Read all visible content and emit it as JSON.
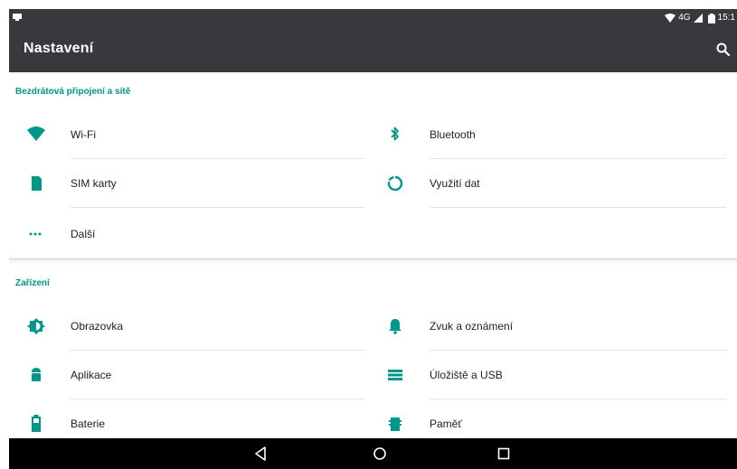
{
  "status_bar": {
    "network": "4G",
    "time": "15:1",
    "icons": [
      "notification-icon",
      "wifi-signal-icon",
      "cell-signal-icon",
      "battery-icon"
    ]
  },
  "toolbar": {
    "title": "Nastavení",
    "search_icon": "search-icon"
  },
  "sections": [
    {
      "header": "Bezdrátová připojení a sítě",
      "items": [
        {
          "label": "Wi-Fi",
          "icon": "wifi-icon"
        },
        {
          "label": "Bluetooth",
          "icon": "bluetooth-icon"
        },
        {
          "label": "SIM karty",
          "icon": "sim-card-icon"
        },
        {
          "label": "Využití dat",
          "icon": "data-usage-icon"
        },
        {
          "label": "Další",
          "icon": "more-icon"
        }
      ]
    },
    {
      "header": "Zařízení",
      "items": [
        {
          "label": "Obrazovka",
          "icon": "display-brightness-icon"
        },
        {
          "label": "Zvuk a oznámení",
          "icon": "bell-icon"
        },
        {
          "label": "Aplikace",
          "icon": "android-icon"
        },
        {
          "label": "Úložiště a USB",
          "icon": "storage-icon"
        },
        {
          "label": "Baterie",
          "icon": "battery-icon"
        },
        {
          "label": "Paměť",
          "icon": "memory-icon"
        }
      ]
    }
  ],
  "navigation_bar": {
    "buttons": [
      "back-icon",
      "home-icon",
      "recents-icon"
    ]
  },
  "colors": {
    "accent": "#009688",
    "toolbar": "#37393c",
    "text": "#212121"
  }
}
